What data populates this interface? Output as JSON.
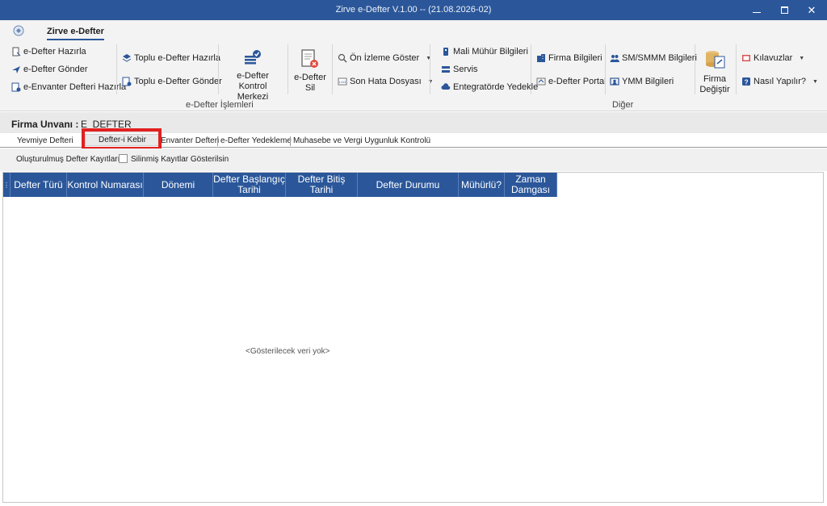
{
  "window": {
    "title": "Zirve e-Defter V.1.00  -- (21.08.2026-02)"
  },
  "ribbon": {
    "active_tab": "Zirve e-Defter",
    "group1": {
      "items": [
        "e-Defter Hazırla",
        "e-Defter Gönder",
        "e-Envanter Defteri Hazırla"
      ],
      "toplu": [
        "Toplu e-Defter Hazırla",
        "Toplu e-Defter Gönder"
      ],
      "kontrol_merkezi_line1": "e-Defter Kontrol",
      "kontrol_merkezi_line2": "Merkezi",
      "sil_line1": "e-Defter",
      "sil_line2": "Sil",
      "onizleme": "Ön İzleme Göster",
      "son_hata": "Son Hata Dosyası",
      "label": "e-Defter İşlemleri"
    },
    "group2": {
      "mali_muhur": "Mali Mühür Bilgileri",
      "servis": "Servis",
      "entegrator": "Entegratörde Yedekle",
      "firma_bilgileri": "Firma Bilgileri",
      "portal": "e-Defter Portal",
      "sm_smmm": "SM/SMMM Bilgileri",
      "ymm": "YMM Bilgileri",
      "firma_degistir_line1": "Firma",
      "firma_degistir_line2": "Değiştir",
      "kilavuzlar": "Kılavuzlar",
      "nasil": "Nasıl Yapılır?",
      "label": "Diğer"
    }
  },
  "firma": {
    "label": "Firma Unvanı :",
    "value": "E_DEFTER"
  },
  "subtabs": [
    "Yevmiye Defteri",
    "Defter-i Kebir",
    "Envanter Defteri",
    "e-Defter Yedekleme",
    "Muhasebe ve Vergi Uygunluk Kontrolü"
  ],
  "filter": {
    "label": "Oluşturulmuş Defter Kayıtları",
    "checkbox_label": "Silinmiş Kayıtlar Gösterilsin"
  },
  "grid": {
    "columns": [
      "",
      "Defter Türü",
      "Kontrol Numarası",
      "Dönemi",
      "Defter Başlangıç Tarihi",
      "Defter Bitiş Tarihi",
      "Defter Durumu",
      "Mühürlü?",
      "Zaman Damgası"
    ],
    "empty_message": "<Gösterilecek veri yok>"
  },
  "colors": {
    "accent": "#2b579a",
    "highlight": "#e12020"
  }
}
